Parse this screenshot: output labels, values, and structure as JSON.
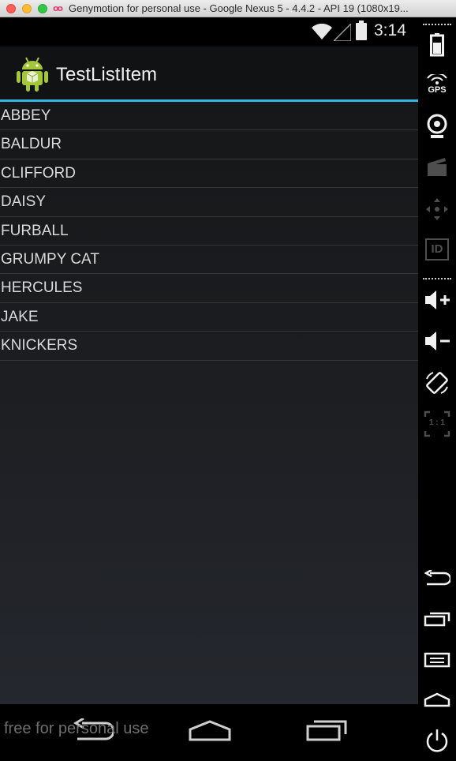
{
  "window": {
    "logo": "oo",
    "title": "Genymotion for personal use - Google Nexus 5 - 4.4.2 - API 19 (1080x19..."
  },
  "statusbar": {
    "time": "3:14"
  },
  "app": {
    "title": "TestListItem"
  },
  "list": {
    "items": [
      "ABBEY",
      "BALDUR",
      "CLIFFORD",
      "DAISY",
      "FURBALL",
      "GRUMPY CAT",
      "HERCULES",
      "JAKE",
      "KNICKERS"
    ]
  },
  "watermark": "free for personal use",
  "sidepanel": {
    "gps_label": "GPS",
    "id_label": "ID",
    "ratio_label": "1 : 1"
  },
  "colors": {
    "accent": "#33b5e5",
    "background": "#1b1d20"
  }
}
